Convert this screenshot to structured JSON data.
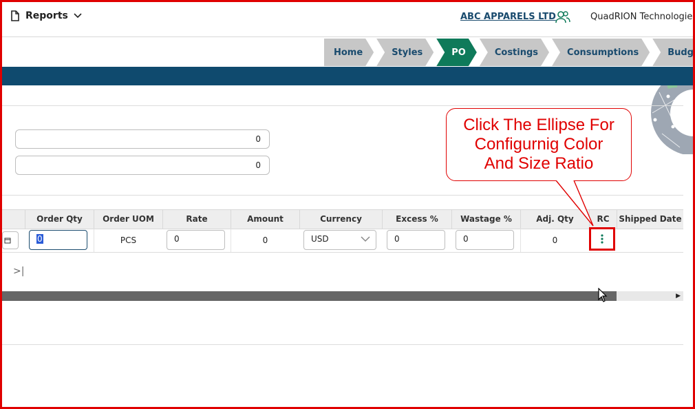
{
  "header": {
    "reports_label": "Reports",
    "company": "ABC APPARELS LTD",
    "org": "QuadRION Technologies"
  },
  "breadcrumbs": [
    "Home",
    "Styles",
    "PO",
    "Costings",
    "Consumptions",
    "Budgets"
  ],
  "active_breadcrumb": "PO",
  "summary_fields": [
    "0",
    "0"
  ],
  "table": {
    "columns": [
      "Order Qty",
      "Order UOM",
      "Rate",
      "Amount",
      "Currency",
      "Excess %",
      "Wastage %",
      "Adj. Qty",
      "RC",
      "Shipped Date"
    ],
    "row": {
      "order_qty": "0",
      "order_uom": "PCS",
      "rate": "0",
      "amount": "0",
      "currency": "USD",
      "excess": "0",
      "wastage": "0",
      "adj_qty": "0",
      "rc_icon": "vertical-ellipsis-icon"
    }
  },
  "pager": {
    "last_label": ">|"
  },
  "callout": {
    "lines": [
      "Click The Ellipse For",
      "Configurnig Color",
      "And Size Ratio"
    ]
  },
  "colors": {
    "brand_blue": "#0f4a6e",
    "active_green": "#0f7a5a",
    "highlight_red": "#e00000"
  }
}
